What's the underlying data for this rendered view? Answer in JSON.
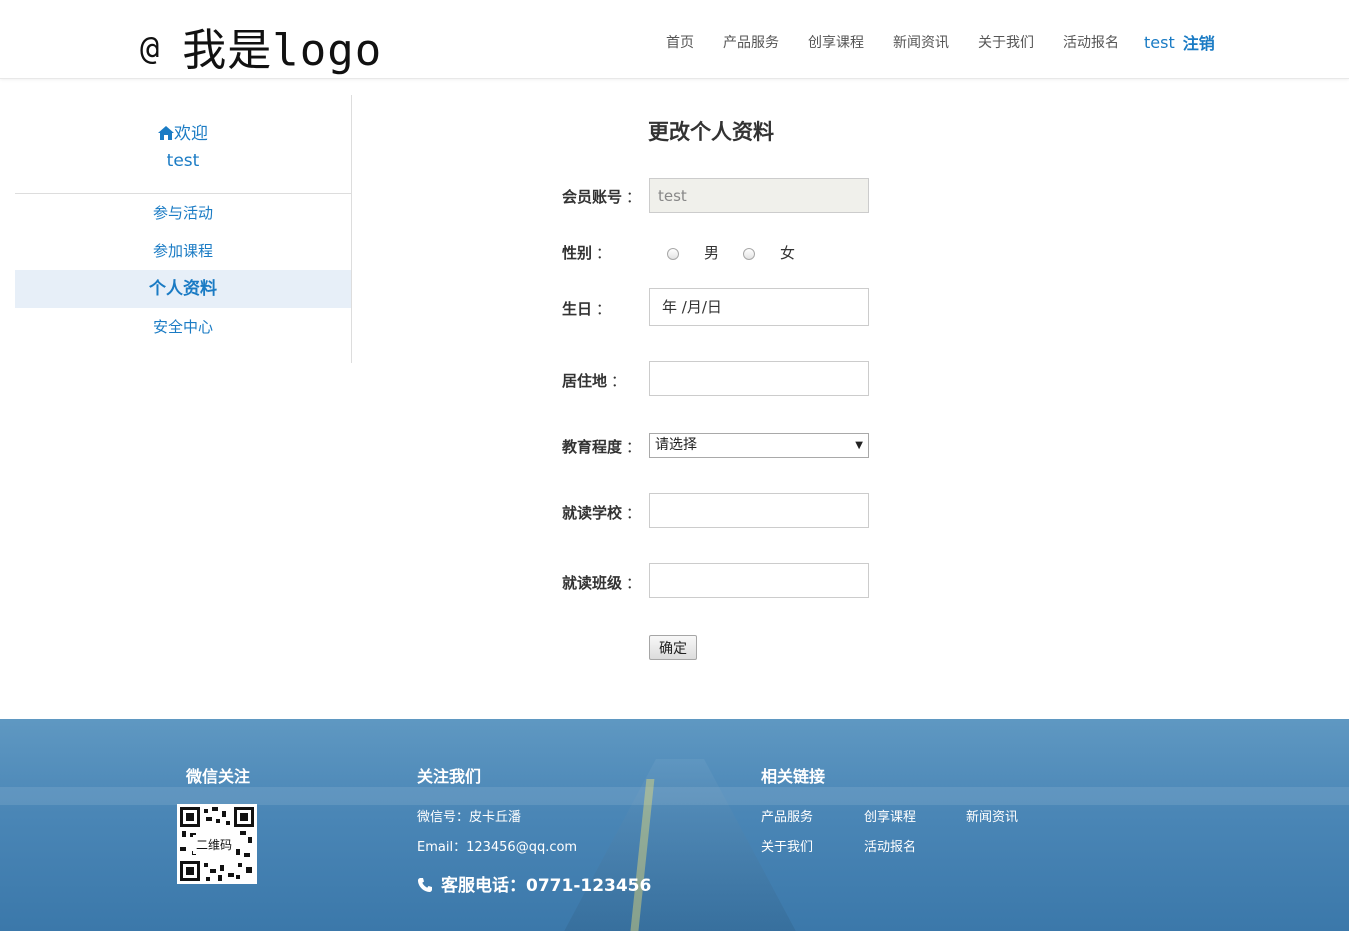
{
  "header": {
    "logo_at": "@",
    "logo_text": "我是logo",
    "nav": [
      "首页",
      "产品服务",
      "创享课程",
      "新闻资讯",
      "关于我们",
      "活动报名"
    ],
    "username": "test",
    "logout": "注销"
  },
  "sidebar": {
    "welcome": "欢迎",
    "username": "test",
    "items": [
      {
        "label": "参与活动",
        "active": false
      },
      {
        "label": "参加课程",
        "active": false
      },
      {
        "label": "个人资料",
        "active": true
      },
      {
        "label": "安全中心",
        "active": false
      }
    ]
  },
  "form": {
    "title": "更改个人资料",
    "colon": "：",
    "account_label": "会员账号",
    "account_value": "test",
    "gender_label": "性别",
    "gender_options": [
      "男",
      "女"
    ],
    "birthday_label": "生日",
    "birthday_placeholder": "年 /月/日",
    "residence_label": "居住地",
    "education_label": "教育程度",
    "education_selected": "请选择",
    "school_label": "就读学校",
    "class_label": "就读班级",
    "submit": "确定"
  },
  "footer": {
    "wechat_heading": "微信关注",
    "qr_label": "二维码",
    "follow_heading": "关注我们",
    "wechat_id": "微信号：皮卡丘潘",
    "email": "Email：123456@qq.com",
    "phone": "客服电话：0771-123456",
    "links_heading": "相关链接",
    "links": [
      "产品服务",
      "创享课程",
      "新闻资讯",
      "关于我们",
      "活动报名"
    ]
  },
  "colors": {
    "accent": "#1a7bc4",
    "active_bg": "#e7eff8",
    "footer_bg": "#4a86b6"
  }
}
